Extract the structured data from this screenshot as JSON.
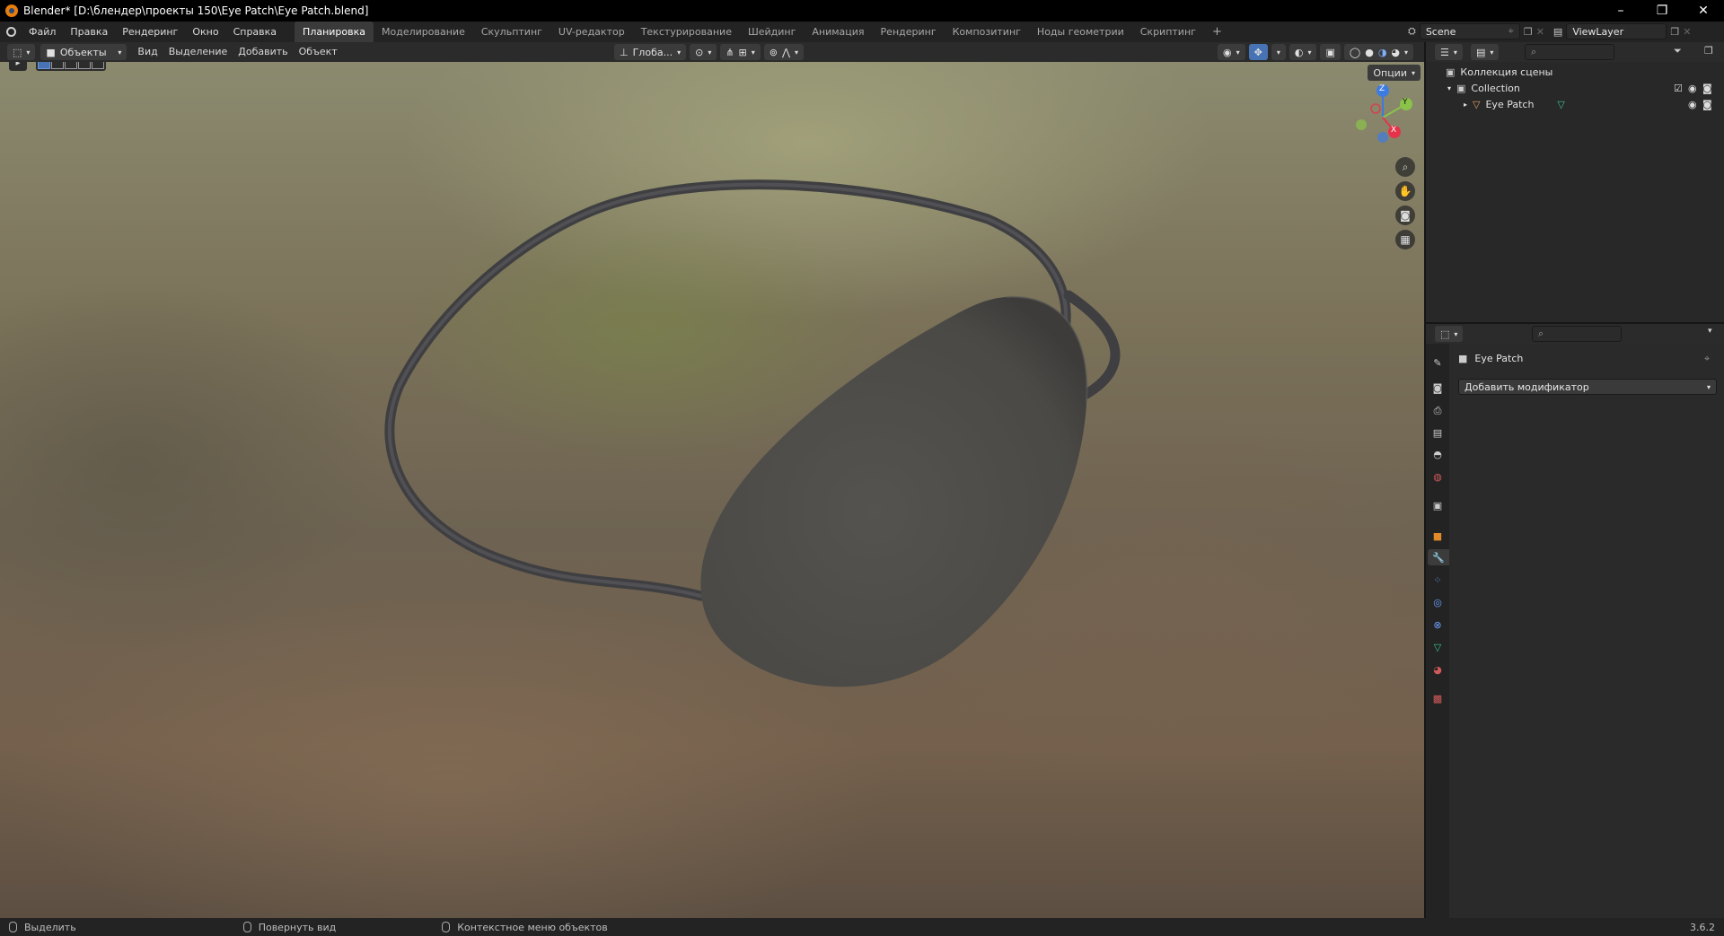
{
  "window": {
    "title": "Blender* [D:\\блендер\\проекты 150\\Eye Patch\\Eye Patch.blend]",
    "controls": [
      "–",
      "❐",
      "✕"
    ]
  },
  "menu": [
    "Файл",
    "Правка",
    "Рендеринг",
    "Окно",
    "Справка"
  ],
  "workspaces": [
    "Планировка",
    "Моделирование",
    "Скульптинг",
    "UV-редактор",
    "Текстурирование",
    "Шейдинг",
    "Анимация",
    "Рендеринг",
    "Композитинг",
    "Ноды геометрии",
    "Скриптинг",
    "+"
  ],
  "active_workspace": "Планировка",
  "scene": {
    "name": "Scene",
    "view_layer": "ViewLayer"
  },
  "viewport_header": {
    "mode": "Объекты",
    "menus": [
      "Вид",
      "Выделение",
      "Добавить",
      "Объект"
    ],
    "orientation": "Глоба...",
    "options_label": "Опции"
  },
  "gizmo": {
    "x": "X",
    "y": "Y",
    "z": "Z"
  },
  "outliner": {
    "root": "Коллекция сцены",
    "collection": "Collection",
    "object": "Eye Patch"
  },
  "properties": {
    "object_name": "Eye Patch",
    "add_modifier": "Добавить модификатор"
  },
  "statusbar": {
    "select": "Выделить",
    "rotate": "Повернуть вид",
    "context": "Контекстное меню объектов",
    "version": "3.6.2"
  },
  "colors": {
    "accent": "#4772b3",
    "axis_x": "#e5334a",
    "axis_y": "#8bc34a",
    "axis_z": "#3e7be0",
    "object": "#4d4c4a"
  }
}
